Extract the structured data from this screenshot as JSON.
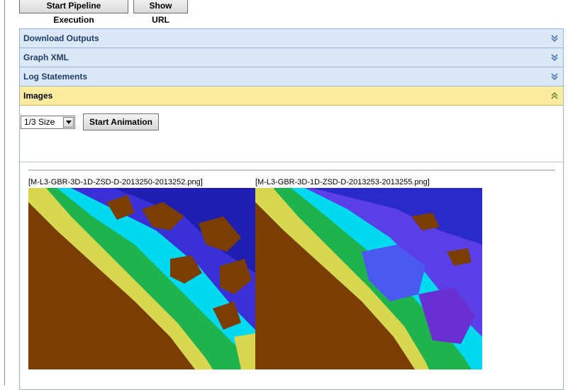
{
  "toolbar": {
    "start_pipeline_label": "Start Pipeline Execution",
    "show_url_label": "Show URL"
  },
  "accordion": {
    "sections": [
      {
        "label": "Download Outputs",
        "expanded": false
      },
      {
        "label": "Graph XML",
        "expanded": false
      },
      {
        "label": "Log Statements",
        "expanded": false
      },
      {
        "label": "Images",
        "expanded": true
      }
    ]
  },
  "images_panel": {
    "size_select_value": "1/3 Size",
    "start_animation_label": "Start Animation",
    "images": [
      {
        "caption": "[M-L3-GBR-3D-1D-ZSD-D-2013250-2013252.png]"
      },
      {
        "caption": "[M-L3-GBR-3D-1D-ZSD-D-2013253-2013255.png]"
      }
    ]
  },
  "colors": {
    "header_bg": "#dbe8f8",
    "header_active_bg": "#fbeca0",
    "land": "#7a3e05",
    "deep_water": "#3b2fd8",
    "shallow": "#00d9f0",
    "reef_green": "#1fb34d",
    "coast_yellow": "#d7d750"
  }
}
